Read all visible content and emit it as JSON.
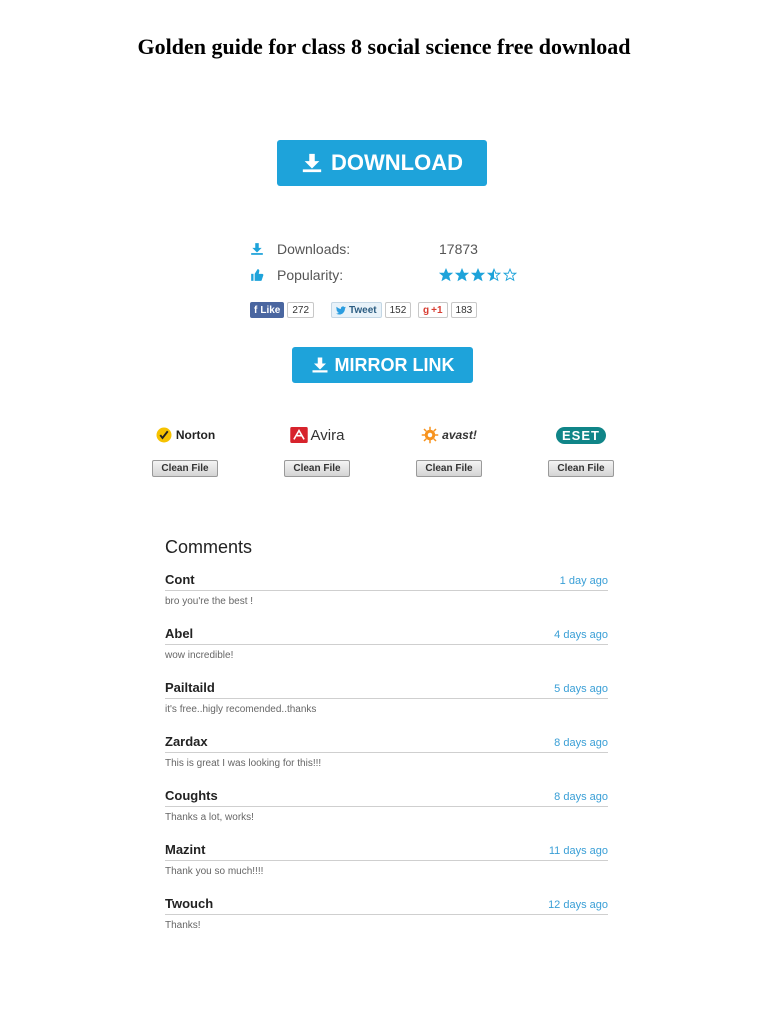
{
  "page": {
    "title": "Golden guide for class 8 social science free download"
  },
  "download": {
    "label": "DOWNLOAD"
  },
  "stats": {
    "downloads_label": "Downloads:",
    "downloads_value": "17873",
    "popularity_label": "Popularity:",
    "popularity_stars": 3.5,
    "popularity_max": 5
  },
  "social": {
    "facebook": {
      "label": "Like",
      "count": "272"
    },
    "twitter": {
      "label": "Tweet",
      "count": "152"
    },
    "gplus": {
      "label": "+1",
      "count": "183"
    }
  },
  "mirror": {
    "label": "MIRROR LINK"
  },
  "antivirus": [
    {
      "name": "Norton",
      "button": "Clean File"
    },
    {
      "name": "Avira",
      "button": "Clean File"
    },
    {
      "name": "avast!",
      "button": "Clean File"
    },
    {
      "name": "ESET",
      "button": "Clean File"
    }
  ],
  "comments": {
    "heading": "Comments",
    "items": [
      {
        "name": "Cont",
        "time": "1 day ago",
        "text": "bro you're the best !"
      },
      {
        "name": "Abel",
        "time": "4 days ago",
        "text": "wow incredible!"
      },
      {
        "name": "Pailtaild",
        "time": "5 days ago",
        "text": "it's free..higly recomended..thanks"
      },
      {
        "name": "Zardax",
        "time": "8 days ago",
        "text": "This is great I was looking for this!!!"
      },
      {
        "name": "Coughts",
        "time": "8 days ago",
        "text": "Thanks a lot, works!"
      },
      {
        "name": "Mazint",
        "time": "11 days ago",
        "text": "Thank you so much!!!!"
      },
      {
        "name": "Twouch",
        "time": "12 days ago",
        "text": "Thanks!"
      }
    ]
  },
  "colors": {
    "accent": "#1ea3da",
    "comment_time": "#3a9fd6",
    "star": "#1ea3da"
  }
}
